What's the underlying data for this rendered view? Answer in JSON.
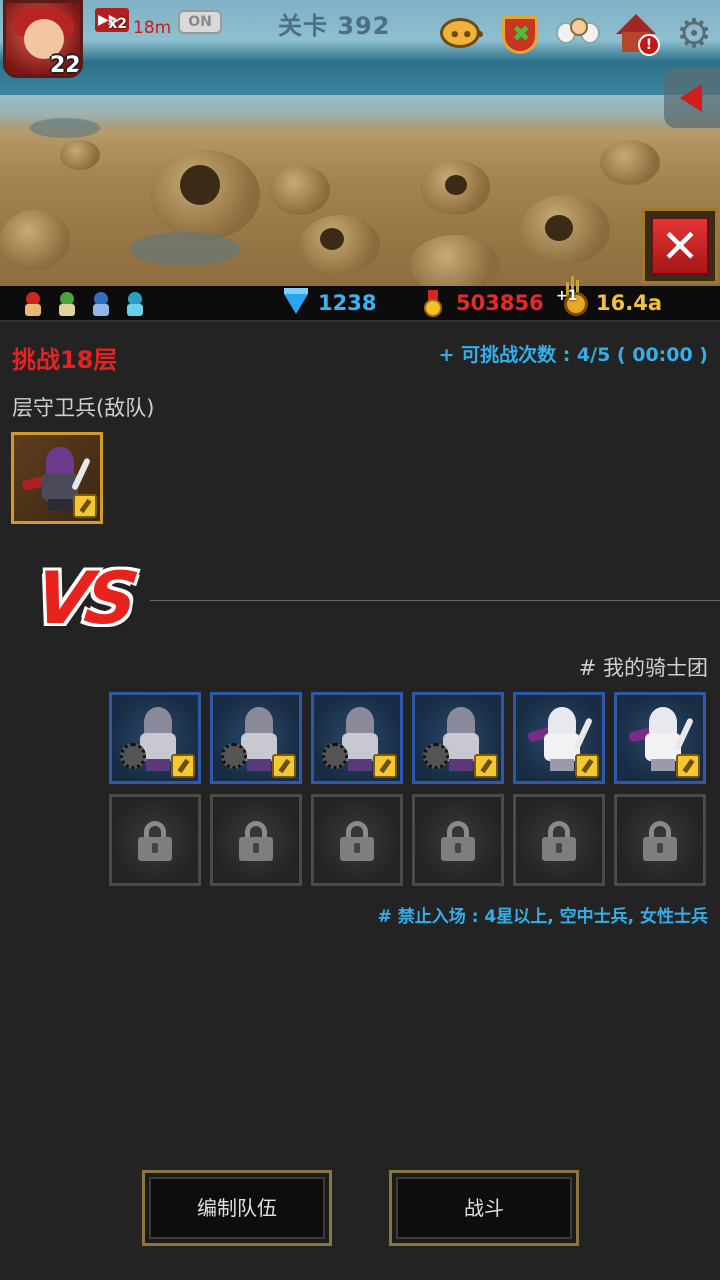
{
  "header": {
    "player_level": "22",
    "speed_multiplier": "x2",
    "speed_time": "18m",
    "toggle_label": "ON",
    "stage_title": "关卡 392"
  },
  "resources": {
    "gems": "1238",
    "medals": "503856",
    "boost_plus": "+1",
    "gold_rate": "16.4a"
  },
  "challenge": {
    "title": "挑战18层",
    "attempts": "+ 可挑战次数 : 4/5 ( 00:00 )",
    "enemy_label": "层守卫兵(敌队)"
  },
  "versus": {
    "vs_text": "VS",
    "my_team_label": "# 我的骑士团",
    "restriction": "# 禁止入场 : 4星以上, 空中士兵, 女性士兵"
  },
  "team": {
    "units": [
      {
        "type": "mace-knight"
      },
      {
        "type": "mace-knight"
      },
      {
        "type": "mace-knight"
      },
      {
        "type": "mace-knight"
      },
      {
        "type": "scarf-swordsman"
      },
      {
        "type": "scarf-swordsman"
      }
    ],
    "locked_slots": 6
  },
  "buttons": {
    "edit_team": "编制队伍",
    "battle": "战斗"
  },
  "colors": {
    "challenge_red": "#e52222",
    "info_blue": "#35aee8",
    "gem_blue": "#3fb3ef",
    "medal_red": "#e52a2a",
    "gold": "#f0c23b"
  }
}
